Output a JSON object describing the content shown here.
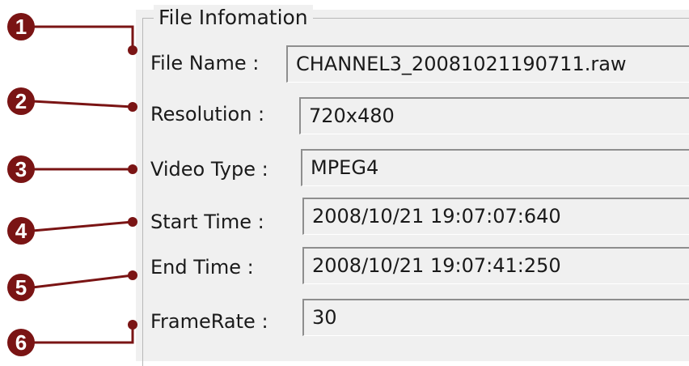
{
  "group": {
    "title": "File Infomation"
  },
  "fields": [
    {
      "label": "File Name :",
      "value": "CHANNEL3_20081021190711.raw"
    },
    {
      "label": "Resolution :",
      "value": "720x480"
    },
    {
      "label": "Video Type :",
      "value": "MPEG4"
    },
    {
      "label": "Start Time :",
      "value": "2008/10/21 19:07:07:640"
    },
    {
      "label": "End Time :",
      "value": "2008/10/21 19:07:41:250"
    },
    {
      "label": "FrameRate :",
      "value": "30"
    }
  ],
  "callouts": [
    "1",
    "2",
    "3",
    "4",
    "5",
    "6"
  ],
  "colors": {
    "callout": "#7a1414",
    "panel": "#f0f0f0",
    "border": "#8e8e8e"
  }
}
